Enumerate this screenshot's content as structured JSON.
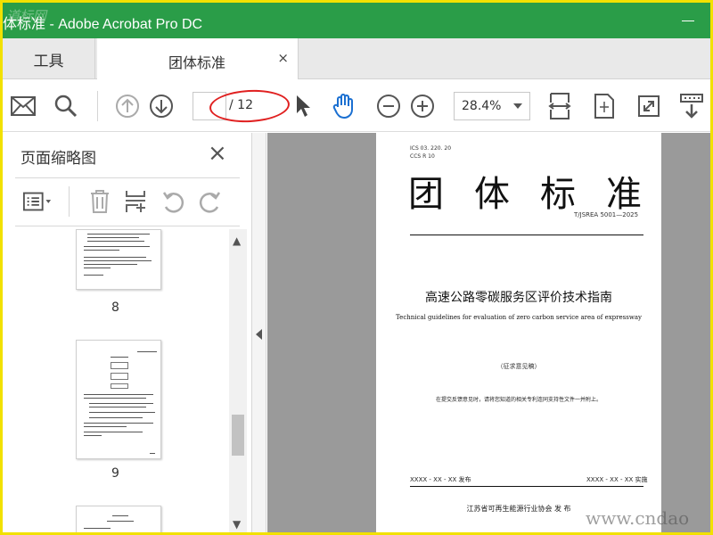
{
  "watermark_top": "道标网",
  "window": {
    "title": "体标准 - Adobe Acrobat Pro DC"
  },
  "tabs": {
    "tools": "工具",
    "document": "团体标准",
    "close": "×"
  },
  "toolbar": {
    "page_current": "",
    "page_total": "/ 12",
    "zoom": "28.4%"
  },
  "sidebar": {
    "title": "页面缩略图",
    "close": "×",
    "thumbnails": [
      {
        "page": "8"
      },
      {
        "page": "9"
      }
    ]
  },
  "document": {
    "ics": "ICS  03. 220. 20",
    "ccs": "CCS  R 10",
    "heading": "团体标准",
    "standard_number": "T/JSREA 5001—2025",
    "title_cn": "高速公路零碳服务区评价技术指南",
    "title_en": "Technical guidelines for evaluation of zero carbon service area of expressway",
    "draft": "（征求意见稿）",
    "note": "在提交反馈意见时，请将您知道的相关专利连同支持性文件一并附上。",
    "release_date": "XXXX - XX - XX 发布",
    "implement_date": "XXXX - XX - XX 实施",
    "publisher": "江苏省可再生能源行业协会          发  布"
  },
  "watermark_bottom": "www.cndao"
}
